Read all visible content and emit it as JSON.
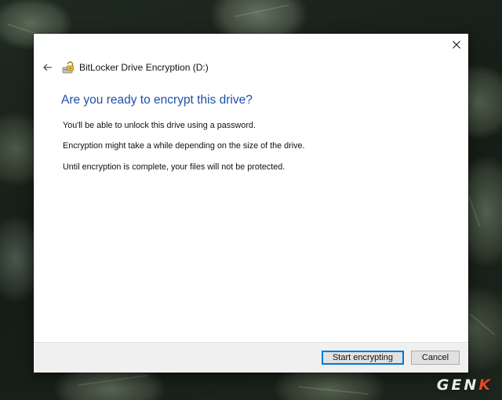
{
  "window": {
    "title": "BitLocker Drive Encryption (D:)",
    "icons": {
      "back": "back-arrow-icon",
      "app": "bitlocker-drive-icon",
      "close": "close-icon"
    }
  },
  "content": {
    "heading": "Are you ready to encrypt this drive?",
    "messages": [
      "You'll be able to unlock this drive using a password.",
      "Encryption might take a while depending on the size of the drive.",
      "Until encryption is complete, your files will not be protected."
    ]
  },
  "buttons": {
    "start_label": "Start encrypting",
    "cancel_label": "Cancel"
  },
  "watermark": {
    "text_main": "GEN",
    "text_accent": "K"
  },
  "colors": {
    "heading": "#1f4fa8",
    "primary_button_border": "#0078d7",
    "footer_background": "#f0f0f0",
    "watermark_accent": "#e24a2a"
  }
}
